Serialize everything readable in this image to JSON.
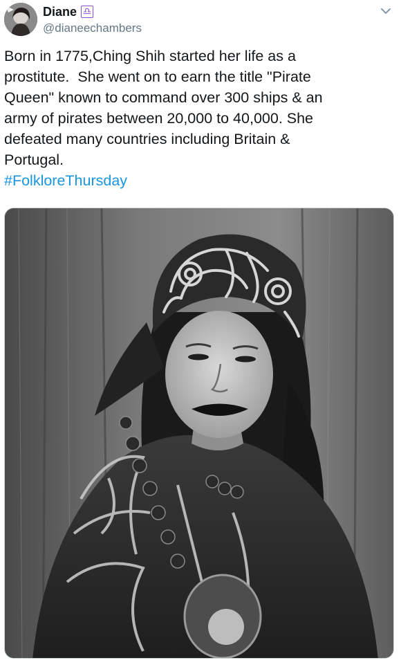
{
  "author": {
    "display_name": "Diane",
    "badge_glyph": "♎",
    "badge_icon": "libra-zodiac-icon",
    "handle": "@dianeechambers",
    "avatar_icon": "profile-photo"
  },
  "menu": {
    "icon": "chevron-down-icon"
  },
  "tweet": {
    "text": "Born in 1775,Ching Shih started her life as a\nprostitute.  She went on to earn the title \"Pirate\nQueen\" known to command over 300 ships & an\narmy of pirates between 20,000 to 40,000. She\ndefeated many countries including Britain &\nPortugal.",
    "hashtag": "#FolkloreThursday"
  },
  "media": {
    "kind": "black-and-white photograph",
    "subject": "portrait of woman in embroidered headwrap"
  },
  "colors": {
    "text": "#14171a",
    "secondary": "#657786",
    "link": "#1b95e0",
    "badge": "#8a4fd6",
    "border": "#ccd6dd"
  }
}
